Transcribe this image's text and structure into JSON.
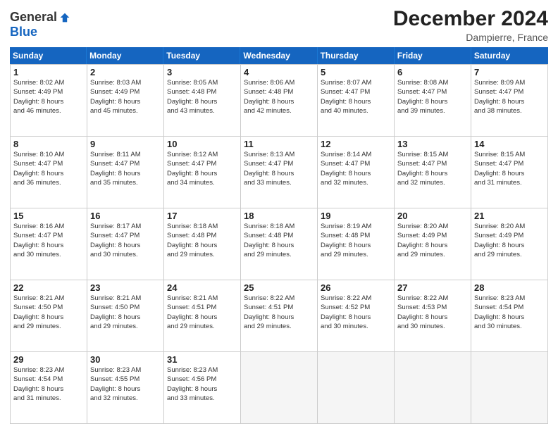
{
  "header": {
    "logo_general": "General",
    "logo_blue": "Blue",
    "month_title": "December 2024",
    "location": "Dampierre, France"
  },
  "weekdays": [
    "Sunday",
    "Monday",
    "Tuesday",
    "Wednesday",
    "Thursday",
    "Friday",
    "Saturday"
  ],
  "rows": [
    [
      {
        "day": "1",
        "info": "Sunrise: 8:02 AM\nSunset: 4:49 PM\nDaylight: 8 hours\nand 46 minutes."
      },
      {
        "day": "2",
        "info": "Sunrise: 8:03 AM\nSunset: 4:49 PM\nDaylight: 8 hours\nand 45 minutes."
      },
      {
        "day": "3",
        "info": "Sunrise: 8:05 AM\nSunset: 4:48 PM\nDaylight: 8 hours\nand 43 minutes."
      },
      {
        "day": "4",
        "info": "Sunrise: 8:06 AM\nSunset: 4:48 PM\nDaylight: 8 hours\nand 42 minutes."
      },
      {
        "day": "5",
        "info": "Sunrise: 8:07 AM\nSunset: 4:47 PM\nDaylight: 8 hours\nand 40 minutes."
      },
      {
        "day": "6",
        "info": "Sunrise: 8:08 AM\nSunset: 4:47 PM\nDaylight: 8 hours\nand 39 minutes."
      },
      {
        "day": "7",
        "info": "Sunrise: 8:09 AM\nSunset: 4:47 PM\nDaylight: 8 hours\nand 38 minutes."
      }
    ],
    [
      {
        "day": "8",
        "info": "Sunrise: 8:10 AM\nSunset: 4:47 PM\nDaylight: 8 hours\nand 36 minutes."
      },
      {
        "day": "9",
        "info": "Sunrise: 8:11 AM\nSunset: 4:47 PM\nDaylight: 8 hours\nand 35 minutes."
      },
      {
        "day": "10",
        "info": "Sunrise: 8:12 AM\nSunset: 4:47 PM\nDaylight: 8 hours\nand 34 minutes."
      },
      {
        "day": "11",
        "info": "Sunrise: 8:13 AM\nSunset: 4:47 PM\nDaylight: 8 hours\nand 33 minutes."
      },
      {
        "day": "12",
        "info": "Sunrise: 8:14 AM\nSunset: 4:47 PM\nDaylight: 8 hours\nand 32 minutes."
      },
      {
        "day": "13",
        "info": "Sunrise: 8:15 AM\nSunset: 4:47 PM\nDaylight: 8 hours\nand 32 minutes."
      },
      {
        "day": "14",
        "info": "Sunrise: 8:15 AM\nSunset: 4:47 PM\nDaylight: 8 hours\nand 31 minutes."
      }
    ],
    [
      {
        "day": "15",
        "info": "Sunrise: 8:16 AM\nSunset: 4:47 PM\nDaylight: 8 hours\nand 30 minutes."
      },
      {
        "day": "16",
        "info": "Sunrise: 8:17 AM\nSunset: 4:47 PM\nDaylight: 8 hours\nand 30 minutes."
      },
      {
        "day": "17",
        "info": "Sunrise: 8:18 AM\nSunset: 4:48 PM\nDaylight: 8 hours\nand 29 minutes."
      },
      {
        "day": "18",
        "info": "Sunrise: 8:18 AM\nSunset: 4:48 PM\nDaylight: 8 hours\nand 29 minutes."
      },
      {
        "day": "19",
        "info": "Sunrise: 8:19 AM\nSunset: 4:48 PM\nDaylight: 8 hours\nand 29 minutes."
      },
      {
        "day": "20",
        "info": "Sunrise: 8:20 AM\nSunset: 4:49 PM\nDaylight: 8 hours\nand 29 minutes."
      },
      {
        "day": "21",
        "info": "Sunrise: 8:20 AM\nSunset: 4:49 PM\nDaylight: 8 hours\nand 29 minutes."
      }
    ],
    [
      {
        "day": "22",
        "info": "Sunrise: 8:21 AM\nSunset: 4:50 PM\nDaylight: 8 hours\nand 29 minutes."
      },
      {
        "day": "23",
        "info": "Sunrise: 8:21 AM\nSunset: 4:50 PM\nDaylight: 8 hours\nand 29 minutes."
      },
      {
        "day": "24",
        "info": "Sunrise: 8:21 AM\nSunset: 4:51 PM\nDaylight: 8 hours\nand 29 minutes."
      },
      {
        "day": "25",
        "info": "Sunrise: 8:22 AM\nSunset: 4:51 PM\nDaylight: 8 hours\nand 29 minutes."
      },
      {
        "day": "26",
        "info": "Sunrise: 8:22 AM\nSunset: 4:52 PM\nDaylight: 8 hours\nand 30 minutes."
      },
      {
        "day": "27",
        "info": "Sunrise: 8:22 AM\nSunset: 4:53 PM\nDaylight: 8 hours\nand 30 minutes."
      },
      {
        "day": "28",
        "info": "Sunrise: 8:23 AM\nSunset: 4:54 PM\nDaylight: 8 hours\nand 30 minutes."
      }
    ],
    [
      {
        "day": "29",
        "info": "Sunrise: 8:23 AM\nSunset: 4:54 PM\nDaylight: 8 hours\nand 31 minutes."
      },
      {
        "day": "30",
        "info": "Sunrise: 8:23 AM\nSunset: 4:55 PM\nDaylight: 8 hours\nand 32 minutes."
      },
      {
        "day": "31",
        "info": "Sunrise: 8:23 AM\nSunset: 4:56 PM\nDaylight: 8 hours\nand 33 minutes."
      },
      {
        "day": "",
        "info": ""
      },
      {
        "day": "",
        "info": ""
      },
      {
        "day": "",
        "info": ""
      },
      {
        "day": "",
        "info": ""
      }
    ]
  ]
}
